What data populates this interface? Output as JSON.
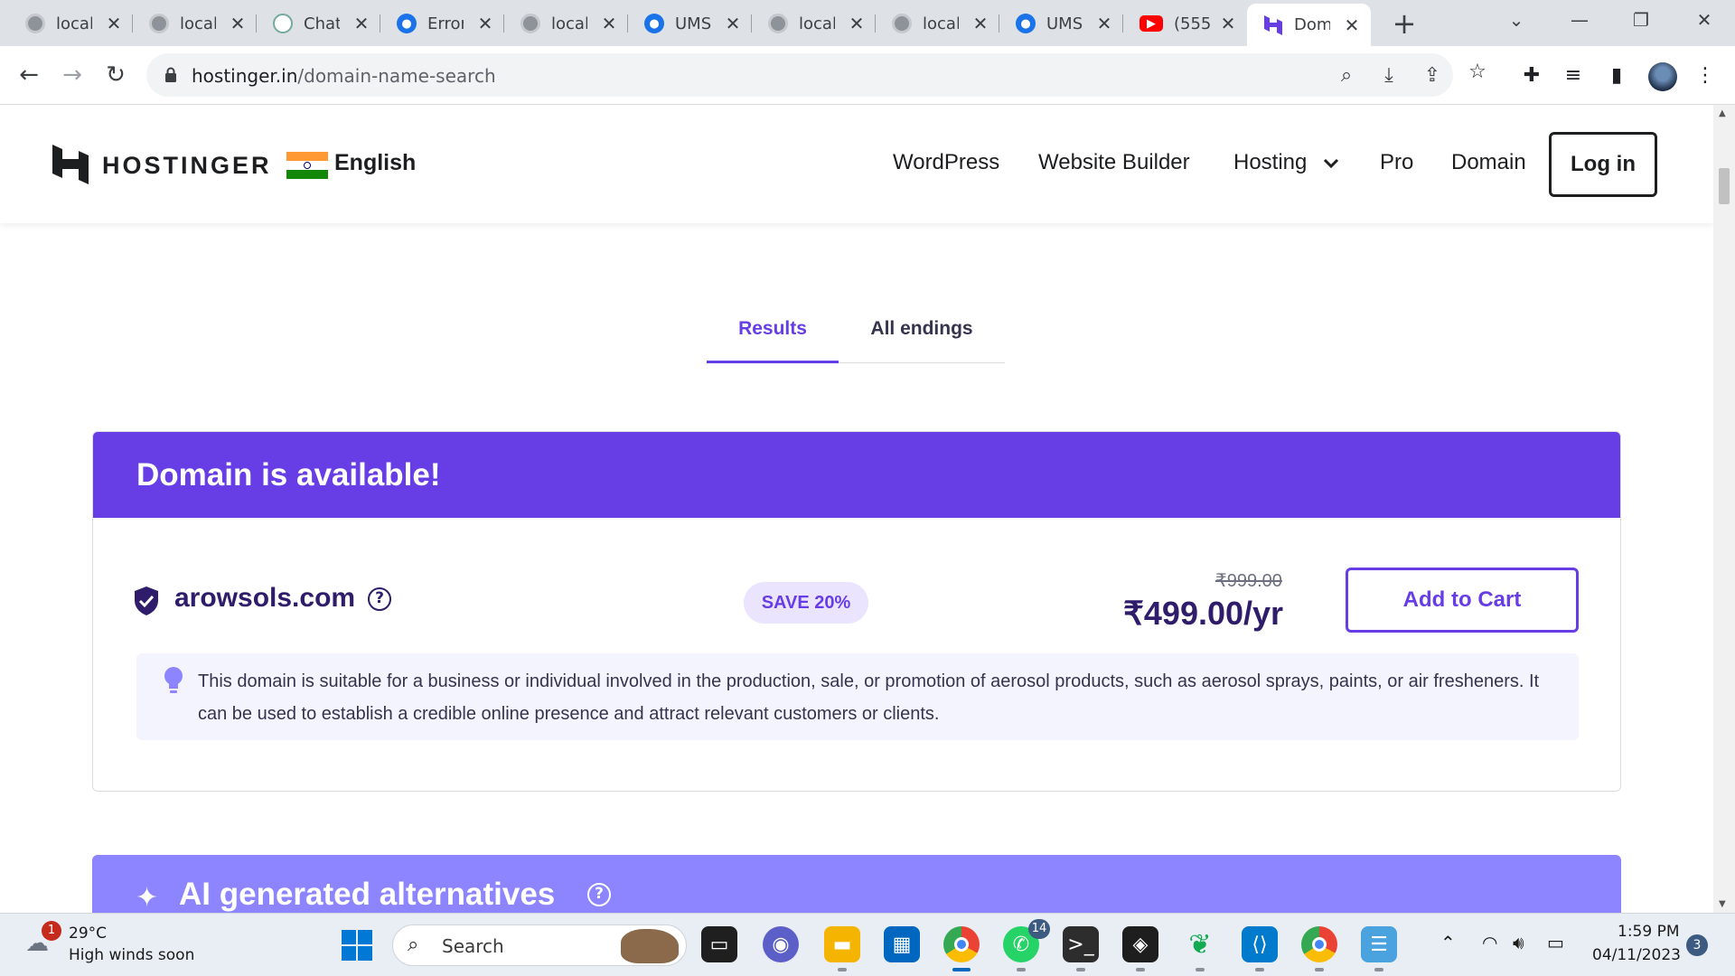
{
  "browser": {
    "tabs": [
      {
        "label": "local",
        "icon": "globe-icon",
        "x": 0
      },
      {
        "label": "local",
        "icon": "globe-icon",
        "x": 0
      },
      {
        "label": "Chat",
        "icon": "chatgpt-icon",
        "x": 0
      },
      {
        "label": "Error",
        "icon": "user-icon",
        "x": 0
      },
      {
        "label": "local",
        "icon": "globe-icon",
        "x": 0
      },
      {
        "label": "UMS",
        "icon": "user-icon",
        "x": 0
      },
      {
        "label": "local",
        "icon": "globe-icon",
        "x": 0
      },
      {
        "label": "local",
        "icon": "globe-icon",
        "x": 0
      },
      {
        "label": "UMS",
        "icon": "user-icon",
        "x": 0
      },
      {
        "label": "(555",
        "icon": "youtube-icon",
        "x": 0
      },
      {
        "label": "Dom",
        "icon": "hostinger-icon",
        "x": 0
      }
    ],
    "url_host": "hostinger.in",
    "url_path": "/domain-name-search"
  },
  "site": {
    "brand": "HOSTINGER",
    "language": "English",
    "nav": {
      "wordpress": "WordPress",
      "website_builder": "Website Builder",
      "hosting": "Hosting",
      "pro": "Pro",
      "domain": "Domain"
    },
    "login": "Log in"
  },
  "search_tabs": {
    "results": "Results",
    "all_endings": "All endings"
  },
  "result": {
    "heading": "Domain is available!",
    "domain": "arowsols.com",
    "save_badge": "SAVE 20%",
    "old_price": "₹999.00",
    "new_price": "₹499.00/yr",
    "add_to_cart": "Add to Cart",
    "description": "This domain is suitable for a business or individual involved in the production, sale, or promotion of aerosol products, such as aerosol sprays, paints, or air fresheners. It can be used to establish a credible online presence and attract relevant customers or clients."
  },
  "ai_section": {
    "title": "AI generated alternatives"
  },
  "colors": {
    "accent": "#673de6",
    "ai_header": "#8c85ff",
    "text_dark": "#2f1c6a"
  },
  "taskbar": {
    "weather_temp": "29°C",
    "weather_desc": "High winds soon",
    "weather_alerts": "1",
    "search_placeholder": "Search",
    "whatsapp_badge": "14",
    "time": "1:59 PM",
    "date": "04/11/2023",
    "notifications": "3"
  }
}
